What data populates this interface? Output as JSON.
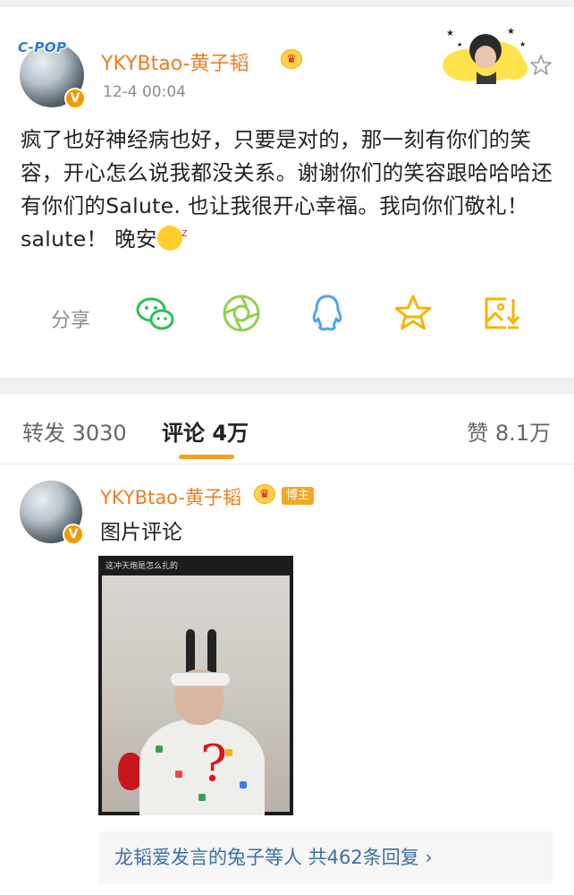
{
  "post": {
    "username": "YKYBtao-黄子韬",
    "timestamp": "12-4 00:04",
    "avatar_badge_text": "C-POP",
    "verified_mark": "V",
    "body": "疯了也好神经病也好，只要是对的，那一刻有你们的笑容，开心怎么说我都没关系。谢谢你们的笑容跟哈哈哈还有你们的Salute. 也让我很开心幸福。我向你们敬礼！salute！ 晚安",
    "share_label": "分享",
    "share_icons": [
      "wechat-icon",
      "moments-icon",
      "qq-icon",
      "favorite-star-icon",
      "save-image-icon"
    ]
  },
  "tabs": {
    "repost": "转发 3030",
    "comments": "评论 4万",
    "likes": "赞 8.1万",
    "active": "comments"
  },
  "comment": {
    "username": "YKYBtao-黄子韬",
    "author_badge": "博主",
    "text": "图片评论",
    "image_caption": "这冲天炮是怎么扎的",
    "replies_text": "龙韬爱发言的兔子等人  共462条回复 ›"
  },
  "colors": {
    "username": "#ee7c1f",
    "link": "#3b6fa8",
    "accent": "#f7a11a",
    "icon_green": "#29c058",
    "icon_lime": "#8fd14f",
    "icon_blue": "#4aa6ea",
    "icon_yellow": "#f5b400"
  }
}
